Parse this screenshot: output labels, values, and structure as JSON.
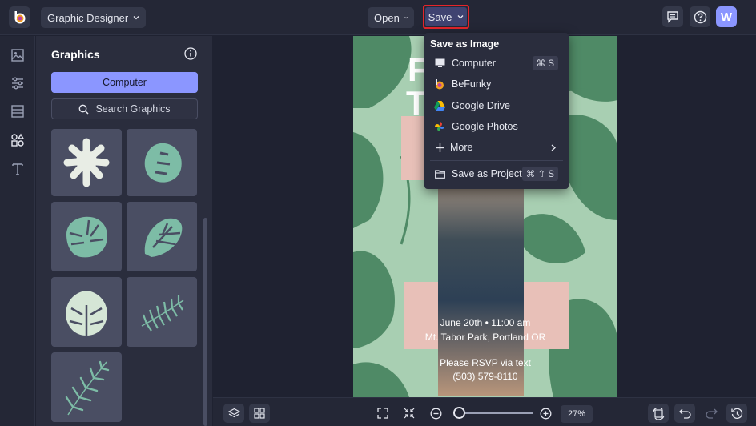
{
  "topbar": {
    "mode_label": "Graphic Designer",
    "open_label": "Open",
    "save_label": "Save",
    "avatar_initial": "W"
  },
  "rail": {
    "items": [
      {
        "name": "image-icon"
      },
      {
        "name": "adjustments-icon"
      },
      {
        "name": "layouts-icon"
      },
      {
        "name": "graphics-icon"
      },
      {
        "name": "text-icon"
      }
    ]
  },
  "panel": {
    "title": "Graphics",
    "computer_label": "Computer",
    "search_label": "Search Graphics",
    "tiles": [
      {
        "name": "palm-leaf-graphic"
      },
      {
        "name": "monstera-round-graphic"
      },
      {
        "name": "monstera-leaf-graphic"
      },
      {
        "name": "monstera-split-graphic"
      },
      {
        "name": "monstera-light-graphic"
      },
      {
        "name": "fern-frond-graphic"
      },
      {
        "name": "palm-frond-graphic"
      }
    ]
  },
  "save_menu": {
    "header": "Save as Image",
    "items": [
      {
        "label": "Computer",
        "icon": "monitor-icon",
        "shortcut": "⌘ S"
      },
      {
        "label": "BeFunky",
        "icon": "befunky-icon",
        "shortcut": ""
      },
      {
        "label": "Google Drive",
        "icon": "google-drive-icon",
        "shortcut": ""
      },
      {
        "label": "Google Photos",
        "icon": "google-photos-icon",
        "shortcut": ""
      },
      {
        "label": "More",
        "icon": "plus-icon",
        "shortcut": ""
      },
      {
        "label": "Save as Project",
        "icon": "folder-icon",
        "shortcut": "⌘ ⇧ S"
      }
    ]
  },
  "canvas": {
    "letters": [
      "F",
      "T"
    ],
    "event_line1": "June 20th • 11:00 am",
    "event_line2": "Mt. Tabor Park, Portland OR",
    "rsvp_line1": "Please RSVP via text",
    "rsvp_line2": "(503) 579-8110"
  },
  "bottombar": {
    "zoom_percent": "27%",
    "zoom_level": 0.27
  },
  "colors": {
    "accent": "#8b96ff",
    "save_highlight": "#e4252b",
    "canvas_bg": "#a8cfb2",
    "leaf_dark": "#4f8a66"
  }
}
